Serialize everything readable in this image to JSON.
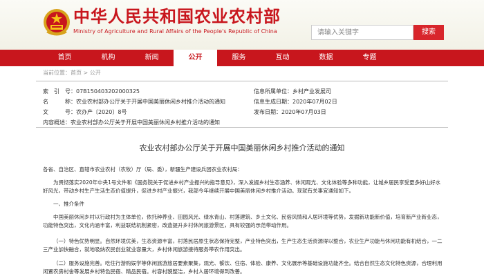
{
  "header": {
    "site_title": "中华人民共和国农业农村部",
    "site_subtitle": "Ministry of Agriculture and Rural Affairs of the People's Republic of China",
    "search_placeholder": "请输入关键字",
    "search_button": "搜索",
    "brand_color": "#c8161d"
  },
  "nav": {
    "items": [
      "首页",
      "机构",
      "新闻",
      "公开",
      "服务",
      "互动",
      "数据",
      "专题"
    ],
    "active_index": 3
  },
  "breadcrumb": {
    "prefix": "当前位置：",
    "home": "首页",
    "sep": " > ",
    "current": "公开"
  },
  "meta": {
    "index_label": "索　引　号：",
    "index_value": "07B150403202000325",
    "name_label": "名　　　称：",
    "name_value": "农业农村部办公厅关于开展中国美丽休闲乡村推介活动的通知",
    "docno_label": "文　　　号：",
    "docno_value": "农办产〔2020〕8号",
    "summary_label": "内容概述：",
    "summary_value": "农业农村部办公厅关于开展中国美丽休闲乡村推介活动的通知",
    "org_label": "信息所属单位：",
    "org_value": "乡村产业发展司",
    "created_label": "信息生成日期：",
    "created_value": "2020年07月02日",
    "published_label": "发布日期：",
    "published_value": "2020年07月03日"
  },
  "article": {
    "title": "农业农村部办公厅关于开展中国美丽休闲乡村推介活动的通知",
    "salutation": "各省、自治区、直辖市农业农村（农牧）厅（局、委），新疆生产建设兵团农业农村局：",
    "p1": "为贯彻落实2020年中央1号文件和《国务院关于促进乡村产业振兴的指导意见》，深入发掘乡村生态涵养、休闲观光、文化体验等多种功能，让城乡居民享受更多好山好水好风光，带动乡村生产生活生态价值提升，促进乡村产业振兴，我部今年继续开展中国美丽休闲乡村推介活动。现就有关事宜通知如下。",
    "section1": "一、推介条件",
    "p2": "中国美丽休闲乡村以行政村为主体单位，依托种养业、田园风光、绿水青山、村落建筑、乡土文化、民俗风情和人居环境等优势，发掘新功能新价值，培育新产业新业态，功能特色突出，文化内涵丰富，利益联结机制紧密，改造提升乡村休闲旅游景区，具有较强的示范带动作用。",
    "p3": "（一）特色优势明显。自然环境优美，生态资源丰富，村落民居原生状态保持完整，产业特色突出，生产生态生活资源得以整合，农业生产功能与休闲功能有机结合，一二三产业加快融合，就地吸纳农民创业就业容量大，乡村休闲旅游接待服务带农作用突出。",
    "p4": "（二）服务设施完善。吃住行游购娱学等休闲旅游旅居要素聚集，观光、餐饮、住宿、体验、康养、文化展示等基础设施功能齐全。结合自然生态文化特色资源，合理利用闲置农房村舍等发展乡村特色民宿、精品民宿。村容村貌整洁，乡村人居环境得到改善。"
  }
}
